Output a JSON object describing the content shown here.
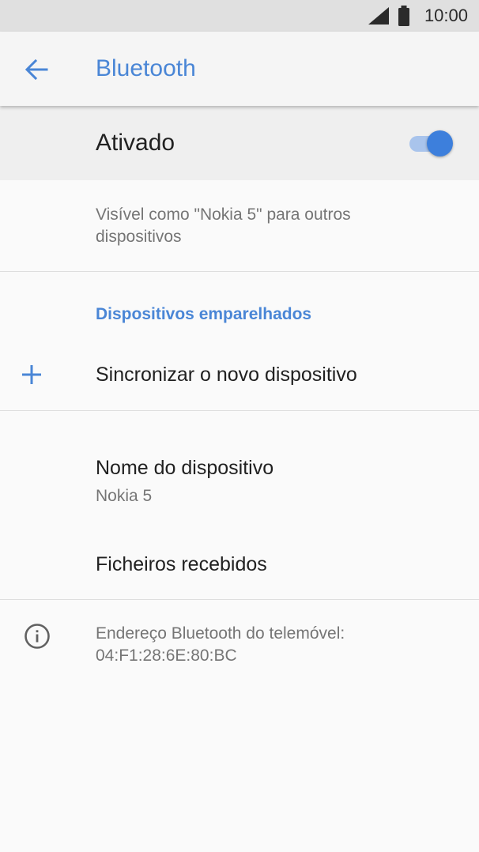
{
  "status_bar": {
    "time": "10:00",
    "icons": [
      "signal-icon",
      "battery-icon"
    ]
  },
  "app_bar": {
    "title": "Bluetooth",
    "back_icon": "arrow-left-icon"
  },
  "master_switch": {
    "label": "Ativado",
    "state": "on"
  },
  "visibility_text": "Visível como \"Nokia 5\" para outros dispositivos",
  "paired_section": {
    "header": "Dispositivos emparelhados",
    "pair_new_label": "Sincronizar o novo dispositivo",
    "pair_new_icon": "plus-icon"
  },
  "device_name": {
    "title": "Nome do dispositivo",
    "value": "Nokia 5"
  },
  "received_files": {
    "title": "Ficheiros recebidos"
  },
  "address": {
    "icon": "info-icon",
    "text_line1": "Endereço Bluetooth do telemóvel:",
    "text_line2": "04:F1:28:6E:80:BC"
  },
  "colors": {
    "accent": "#4a86d6",
    "toggle_thumb": "#3d7fdc",
    "toggle_track": "#a9c4ec",
    "status_bar_bg": "#e0e0e0",
    "app_bar_bg": "#f5f5f5",
    "master_row_bg": "#efefef",
    "page_bg": "#fafafa"
  }
}
